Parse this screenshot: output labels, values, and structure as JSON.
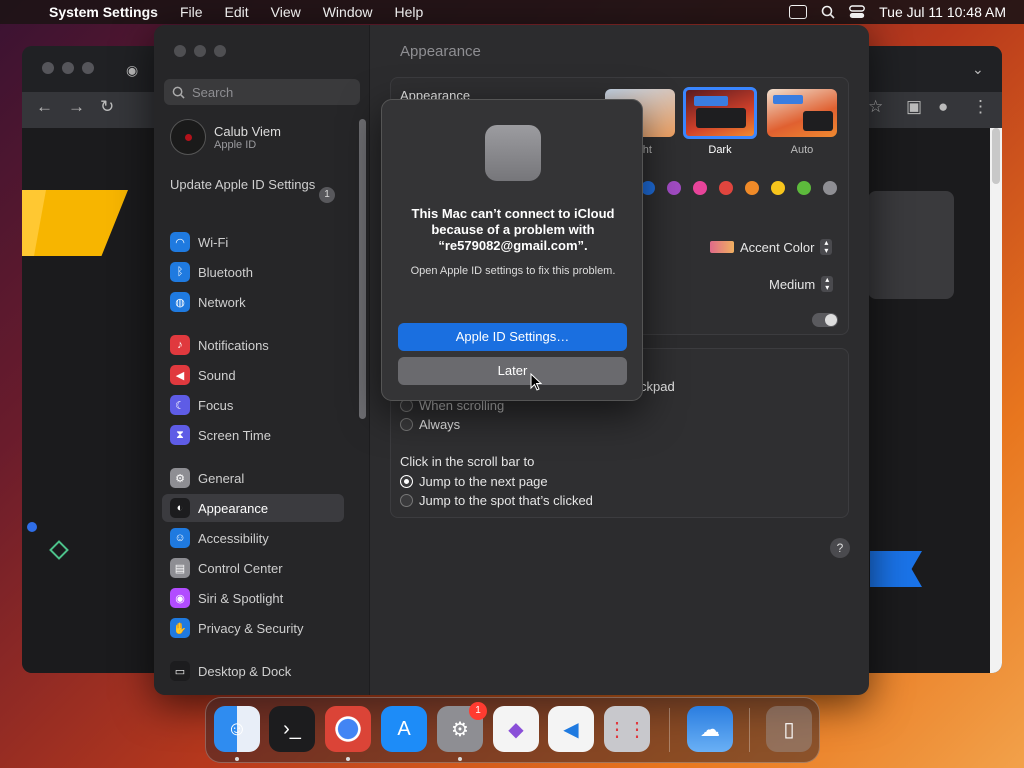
{
  "menubar": {
    "app_name": "System Settings",
    "items": [
      "File",
      "Edit",
      "View",
      "Window",
      "Help"
    ],
    "clock": "Tue Jul 11  10:48 AM"
  },
  "sidebar": {
    "search_placeholder": "Search",
    "profile": {
      "name": "Calub Viem",
      "subtitle": "Apple ID"
    },
    "update": {
      "label": "Update Apple ID Settings",
      "badge": "1"
    },
    "items": [
      {
        "label": "Wi-Fi",
        "icon": "wifi-icon",
        "color": "#1f7ae0"
      },
      {
        "label": "Bluetooth",
        "icon": "bluetooth-icon",
        "color": "#1f7ae0"
      },
      {
        "label": "Network",
        "icon": "globe-icon",
        "color": "#1f7ae0"
      },
      {
        "label": "Notifications",
        "icon": "bell-icon",
        "color": "#e0393e"
      },
      {
        "label": "Sound",
        "icon": "speaker-icon",
        "color": "#e0393e"
      },
      {
        "label": "Focus",
        "icon": "moon-icon",
        "color": "#5e5ce6"
      },
      {
        "label": "Screen Time",
        "icon": "hourglass-icon",
        "color": "#5e5ce6"
      },
      {
        "label": "General",
        "icon": "gear-icon",
        "color": "#8e8e93"
      },
      {
        "label": "Appearance",
        "icon": "appearance-icon",
        "color": "#1c1c1e"
      },
      {
        "label": "Accessibility",
        "icon": "accessibility-icon",
        "color": "#1f7ae0"
      },
      {
        "label": "Control Center",
        "icon": "control-center-icon",
        "color": "#8e8e93"
      },
      {
        "label": "Siri & Spotlight",
        "icon": "siri-icon",
        "color": "#b24cff"
      },
      {
        "label": "Privacy & Security",
        "icon": "hand-icon",
        "color": "#1f7ae0"
      },
      {
        "label": "Desktop & Dock",
        "icon": "dock-icon",
        "color": "#1c1c1e"
      }
    ],
    "selected": "Appearance"
  },
  "main": {
    "title": "Appearance",
    "appearance_row_label": "Appearance",
    "modes": [
      "Light",
      "Dark",
      "Auto"
    ],
    "selected_mode": "Dark",
    "accent_colors": [
      "#1f6fe0",
      "#a24cc4",
      "#e8449a",
      "#e0453e",
      "#f08a28",
      "#f7c51c",
      "#5dba3c",
      "#8e8e93"
    ],
    "accent_popup": "Accent Color",
    "sidebar_icon_size": "Medium",
    "scroll_partial_label": "ckpad",
    "show_scroll_options": [
      "When scrolling",
      "Always"
    ],
    "click_scroll_label": "Click in the scroll bar to",
    "click_scroll_options": [
      "Jump to the next page",
      "Jump to the spot that’s clicked"
    ],
    "click_scroll_selected": "Jump to the next page",
    "help": "?"
  },
  "dialog": {
    "title": "This Mac can’t connect to iCloud because of a problem with “re579082@gmail.com”.",
    "message": "Open Apple ID settings to fix this problem.",
    "primary_button": "Apple ID Settings…",
    "secondary_button": "Later"
  },
  "dock": {
    "apps": [
      "Finder",
      "Terminal",
      "Chrome",
      "App Store",
      "System Settings",
      "Visual Studio",
      "VS Code",
      "Launchpad",
      "Weather",
      "Trash"
    ],
    "settings_badge": "1"
  }
}
